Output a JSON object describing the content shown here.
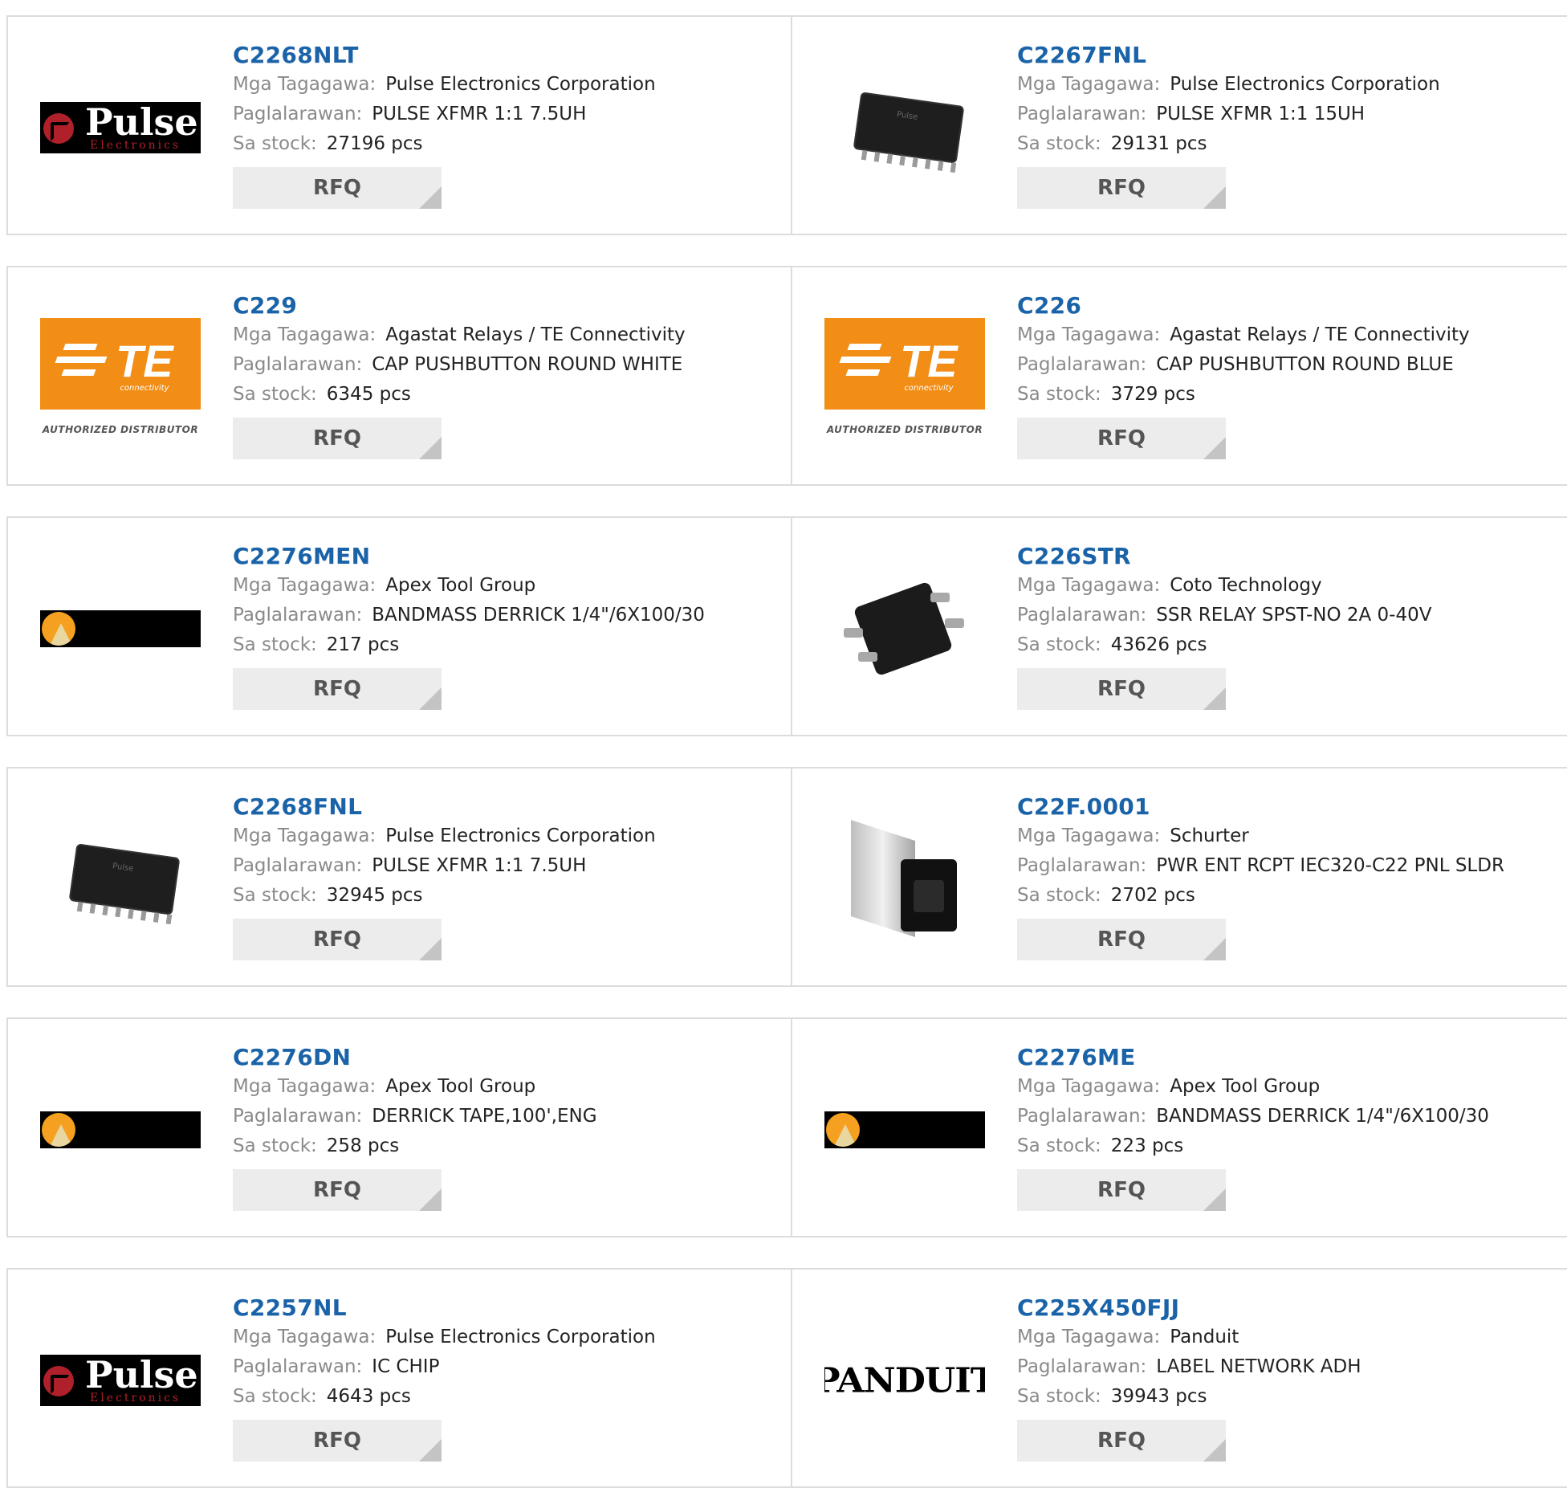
{
  "labels": {
    "manufacturer": "Mga Tagagawa:",
    "description": "Paglalarawan:",
    "stock": "Sa stock:",
    "rfq": "RFQ"
  },
  "products": [
    {
      "part": "C2268NLT",
      "manufacturer": "Pulse Electronics Corporation",
      "description": "PULSE XFMR 1:1 7.5UH",
      "stock": "27196 pcs",
      "image": "pulse-logo"
    },
    {
      "part": "C2267FNL",
      "manufacturer": "Pulse Electronics Corporation",
      "description": "PULSE XFMR 1:1 15UH",
      "stock": "29131 pcs",
      "image": "transformer-chip"
    },
    {
      "part": "C229",
      "manufacturer": "Agastat Relays / TE Connectivity",
      "description": "CAP PUSHBUTTON ROUND WHITE",
      "stock": "6345 pcs",
      "image": "te-logo"
    },
    {
      "part": "C226",
      "manufacturer": "Agastat Relays / TE Connectivity",
      "description": "CAP PUSHBUTTON ROUND BLUE",
      "stock": "3729 pcs",
      "image": "te-logo"
    },
    {
      "part": "C2276MEN",
      "manufacturer": "Apex Tool Group",
      "description": "BANDMASS DERRICK 1/4\"/6X100/30",
      "stock": "217 pcs",
      "image": "apex-logo"
    },
    {
      "part": "C226STR",
      "manufacturer": "Coto Technology",
      "description": "SSR RELAY SPST-NO 2A 0-40V",
      "stock": "43626 pcs",
      "image": "ssr-relay"
    },
    {
      "part": "C2268FNL",
      "manufacturer": "Pulse Electronics Corporation",
      "description": "PULSE XFMR 1:1 7.5UH",
      "stock": "32945 pcs",
      "image": "transformer-chip"
    },
    {
      "part": "C22F.0001",
      "manufacturer": "Schurter",
      "description": "PWR ENT RCPT IEC320-C22 PNL SLDR",
      "stock": "2702 pcs",
      "image": "iec-connector"
    },
    {
      "part": "C2276DN",
      "manufacturer": "Apex Tool Group",
      "description": "DERRICK TAPE,100',ENG",
      "stock": "258 pcs",
      "image": "apex-logo"
    },
    {
      "part": "C2276ME",
      "manufacturer": "Apex Tool Group",
      "description": "BANDMASS DERRICK 1/4\"/6X100/30",
      "stock": "223 pcs",
      "image": "apex-logo"
    },
    {
      "part": "C2257NL",
      "manufacturer": "Pulse Electronics Corporation",
      "description": "IC CHIP",
      "stock": "4643 pcs",
      "image": "pulse-logo"
    },
    {
      "part": "C225X450FJJ",
      "manufacturer": "Panduit",
      "description": "LABEL NETWORK ADH",
      "stock": "39943 pcs",
      "image": "panduit-logo"
    }
  ],
  "logo_text": {
    "pulse_word": "Pulse",
    "pulse_sub": "Electronics",
    "te_word": "TE",
    "te_sub": "connectivity",
    "te_auth": "AUTHORIZED DISTRIBUTOR",
    "panduit": "PANDUIT",
    "chip_marking": "Pulse"
  },
  "colors": {
    "part_link": "#1a63a8",
    "te_orange": "#f28d16",
    "pulse_red": "#b0202a",
    "apex_orange": "#f5a020"
  }
}
